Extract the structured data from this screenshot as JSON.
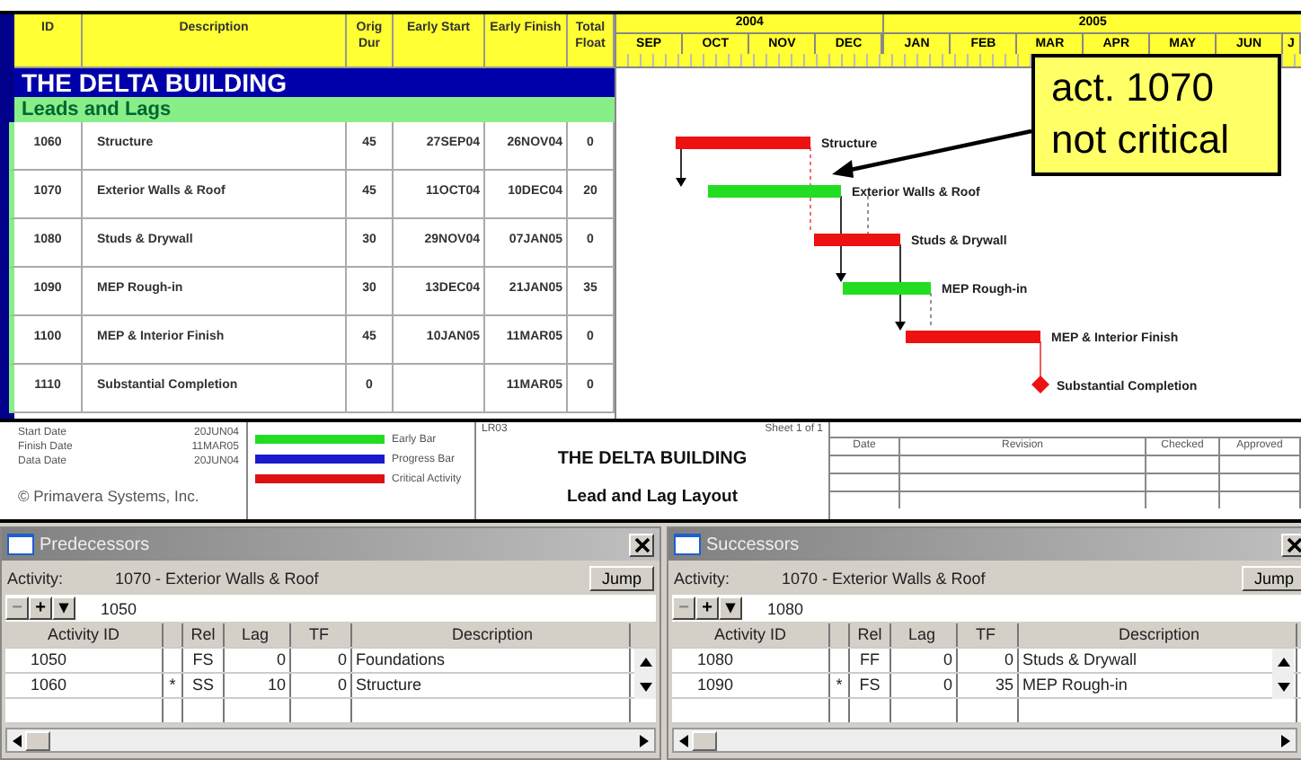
{
  "schedule": {
    "columns": [
      "ID",
      "Description",
      "Orig Dur",
      "Early Start",
      "Early Finish",
      "Total Float"
    ],
    "project_title": "THE DELTA BUILDING",
    "group_title": "Leads and Lags",
    "activities": [
      {
        "id": "1060",
        "description": "Structure",
        "orig_dur": "45",
        "early_start": "27SEP04",
        "early_finish": "26NOV04",
        "total_float": "0",
        "kind": "task",
        "critical": true,
        "bar_label": "Structure"
      },
      {
        "id": "1070",
        "description": "Exterior Walls & Roof",
        "orig_dur": "45",
        "early_start": "11OCT04",
        "early_finish": "10DEC04",
        "total_float": "20",
        "kind": "task",
        "critical": false,
        "bar_label": "Exterior Walls & Roof"
      },
      {
        "id": "1080",
        "description": "Studs & Drywall",
        "orig_dur": "30",
        "early_start": "29NOV04",
        "early_finish": "07JAN05",
        "total_float": "0",
        "kind": "task",
        "critical": true,
        "bar_label": "Studs & Drywall"
      },
      {
        "id": "1090",
        "description": "MEP Rough-in",
        "orig_dur": "30",
        "early_start": "13DEC04",
        "early_finish": "21JAN05",
        "total_float": "35",
        "kind": "task",
        "critical": false,
        "bar_label": "MEP Rough-in"
      },
      {
        "id": "1100",
        "description": "MEP & Interior Finish",
        "orig_dur": "45",
        "early_start": "10JAN05",
        "early_finish": "11MAR05",
        "total_float": "0",
        "kind": "task",
        "critical": true,
        "bar_label": "MEP & Interior Finish"
      },
      {
        "id": "1110",
        "description": "Substantial Completion",
        "orig_dur": "0",
        "early_finish": "11MAR05",
        "total_float": "0",
        "kind": "milestone",
        "critical": true,
        "bar_label": "Substantial Completion"
      }
    ]
  },
  "timeline": {
    "years": [
      {
        "label": "2004",
        "months": [
          "SEP",
          "OCT",
          "NOV",
          "DEC"
        ]
      },
      {
        "label": "2005",
        "months": [
          "JAN",
          "FEB",
          "MAR",
          "APR",
          "MAY",
          "JUN",
          "J"
        ]
      }
    ]
  },
  "callout": {
    "lines": [
      "act. 1070",
      "not critical"
    ]
  },
  "title_block": {
    "dates": [
      {
        "label": "Start Date",
        "value": "20JUN04"
      },
      {
        "label": "Finish Date",
        "value": "11MAR05"
      },
      {
        "label": "Data Date",
        "value": "20JUN04"
      }
    ],
    "copyright": "© Primavera Systems, Inc.",
    "legend": [
      {
        "label": "Early Bar",
        "color": "#22dd22"
      },
      {
        "label": "Progress Bar",
        "color": "#1a1acc"
      },
      {
        "label": "Critical Activity",
        "color": "#dd1111"
      }
    ],
    "layout_code": "LR03",
    "sheet": "Sheet 1 of 1",
    "project": "THE DELTA BUILDING",
    "layout_name": "Lead and Lag Layout",
    "revision_columns": [
      "Date",
      "Revision",
      "Checked",
      "Approved"
    ]
  },
  "panels": [
    {
      "title": "Predecessors",
      "activity_label": "Activity:",
      "activity": "1070 -  Exterior Walls & Roof",
      "jump": "Jump",
      "toolbar_buttons": [
        "−",
        "+",
        "▾"
      ],
      "field_value": "1050",
      "columns": [
        "Activity ID",
        "Rel",
        "Lag",
        "TF",
        "Description"
      ],
      "rows": [
        {
          "activity_id": "1050",
          "rel": "FS",
          "lag": "0",
          "tf": "0",
          "description": "Foundations"
        },
        {
          "activity_id": "1060",
          "flag": "*",
          "rel": "SS",
          "lag": "10",
          "tf": "0",
          "description": "Structure"
        }
      ]
    },
    {
      "title": "Successors",
      "activity_label": "Activity:",
      "activity": "1070 -  Exterior Walls & Roof",
      "jump": "Jump",
      "toolbar_buttons": [
        "−",
        "+",
        "▾"
      ],
      "field_value": "1080",
      "columns": [
        "Activity ID",
        "Rel",
        "Lag",
        "TF",
        "Description"
      ],
      "rows": [
        {
          "activity_id": "1080",
          "rel": "FF",
          "lag": "0",
          "tf": "0",
          "description": "Studs & Drywall"
        },
        {
          "activity_id": "1090",
          "flag": "*",
          "rel": "FS",
          "lag": "0",
          "tf": "35",
          "description": "MEP Rough-in"
        }
      ]
    }
  ]
}
